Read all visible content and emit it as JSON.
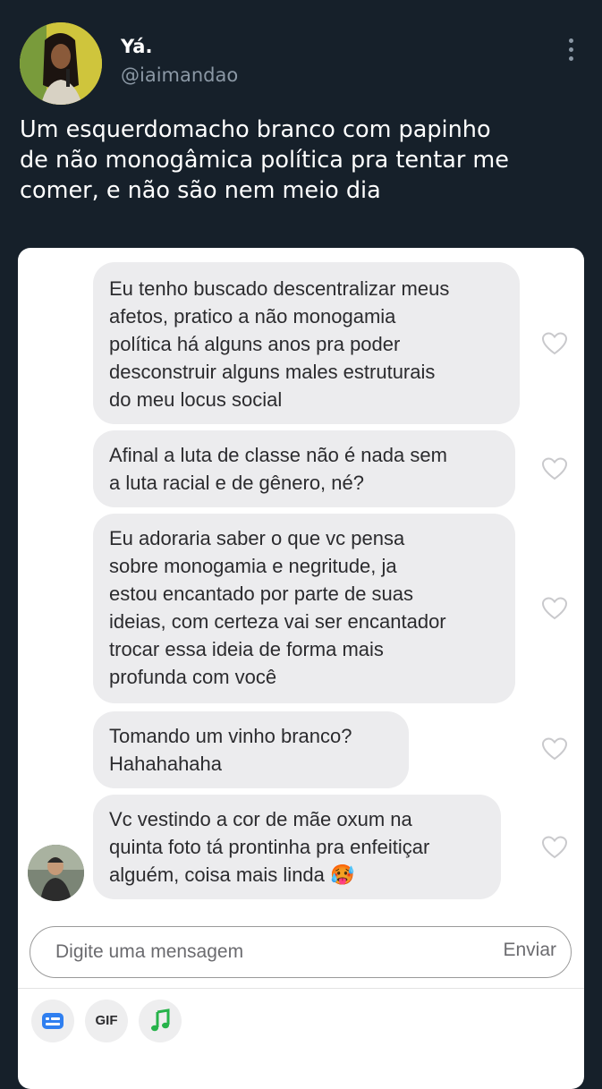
{
  "tweet": {
    "display_name": "Yá.",
    "handle": "@iaimandao",
    "text": "Um esquerdomacho branco com papinho\nde não monogâmica política pra tentar me\ncomer, e não são nem meio dia"
  },
  "chat": {
    "messages": [
      {
        "text": "Eu tenho buscado descentralizar meus\nafetos, pratico a não monogamia\npolítica há alguns anos pra poder\ndesconstruir alguns males estruturais\ndo meu locus social"
      },
      {
        "text": "Afinal a luta de classe não é nada sem\na luta racial e de gênero, né?"
      },
      {
        "text": "Eu adoraria saber o que vc pensa\nsobre monogamia e negritude, ja\nestou encantado por parte de suas\nideias, com certeza vai ser encantador\ntrocar essa ideia de forma mais\nprofunda com você"
      },
      {
        "text": "Tomando um vinho branco?\nHahahahaha"
      },
      {
        "text": "Vc vestindo a cor de mãe oxum na\nquinta foto tá prontinha pra enfeitiçar\nalguém, coisa mais linda 🥵"
      }
    ],
    "composer": {
      "placeholder": "Digite uma mensagem",
      "send_label": "Enviar"
    },
    "tools": {
      "gif_label": "GIF"
    }
  },
  "colors": {
    "background": "#16202a",
    "bubble": "#ececee",
    "card": "#ffffff",
    "accent_blue": "#2f7ff0",
    "accent_green": "#26b34a"
  }
}
